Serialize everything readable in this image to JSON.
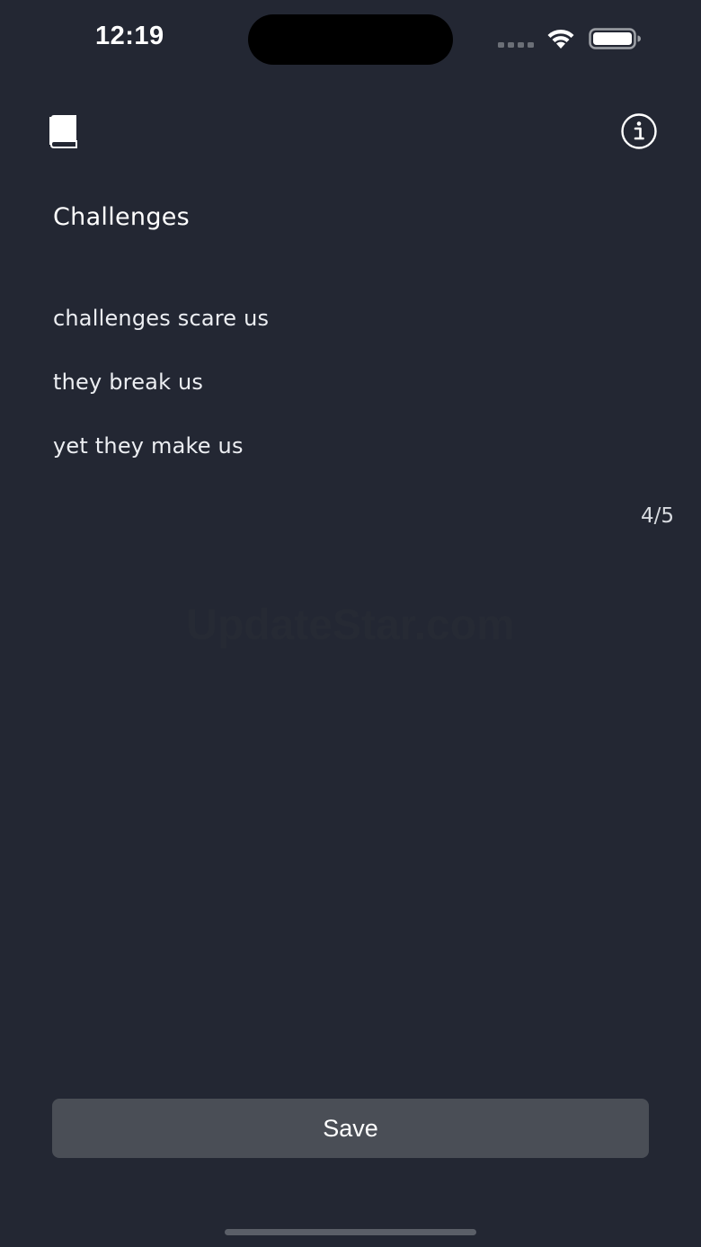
{
  "status_bar": {
    "time": "12:19"
  },
  "header": {
    "left_icon": "book-icon",
    "right_icon": "info-icon"
  },
  "content": {
    "title": "Challenges",
    "lines": [
      "challenges scare us",
      "they break us",
      "yet they make us"
    ],
    "counter": "4/5",
    "watermark": "UpdateStar.com"
  },
  "footer": {
    "save_label": "Save"
  },
  "colors": {
    "background": "#232733",
    "button": "#4a4e56",
    "text": "#ffffff"
  }
}
